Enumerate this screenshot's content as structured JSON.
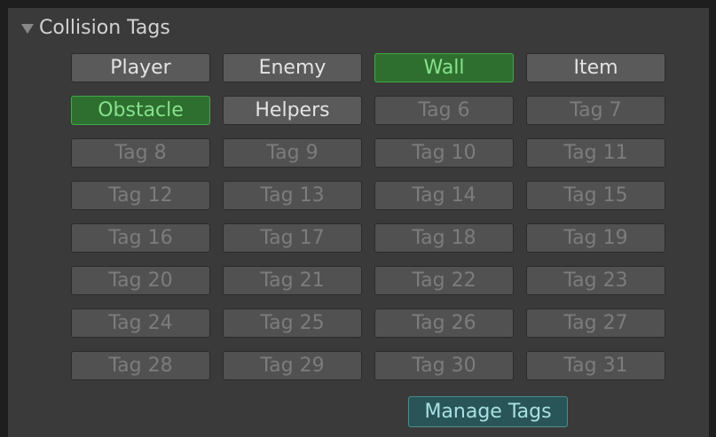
{
  "section": {
    "title": "Collision Tags",
    "caret_icon": "triangle-down-icon"
  },
  "tags": [
    {
      "label": "Player",
      "state": "named"
    },
    {
      "label": "Enemy",
      "state": "named"
    },
    {
      "label": "Wall",
      "state": "active"
    },
    {
      "label": "Item",
      "state": "named"
    },
    {
      "label": "Obstacle",
      "state": "active"
    },
    {
      "label": "Helpers",
      "state": "named"
    },
    {
      "label": "Tag 6",
      "state": "unused"
    },
    {
      "label": "Tag 7",
      "state": "unused"
    },
    {
      "label": "Tag 8",
      "state": "unused"
    },
    {
      "label": "Tag 9",
      "state": "unused"
    },
    {
      "label": "Tag 10",
      "state": "unused"
    },
    {
      "label": "Tag 11",
      "state": "unused"
    },
    {
      "label": "Tag 12",
      "state": "unused"
    },
    {
      "label": "Tag 13",
      "state": "unused"
    },
    {
      "label": "Tag 14",
      "state": "unused"
    },
    {
      "label": "Tag 15",
      "state": "unused"
    },
    {
      "label": "Tag 16",
      "state": "unused"
    },
    {
      "label": "Tag 17",
      "state": "unused"
    },
    {
      "label": "Tag 18",
      "state": "unused"
    },
    {
      "label": "Tag 19",
      "state": "unused"
    },
    {
      "label": "Tag 20",
      "state": "unused"
    },
    {
      "label": "Tag 21",
      "state": "unused"
    },
    {
      "label": "Tag 22",
      "state": "unused"
    },
    {
      "label": "Tag 23",
      "state": "unused"
    },
    {
      "label": "Tag 24",
      "state": "unused"
    },
    {
      "label": "Tag 25",
      "state": "unused"
    },
    {
      "label": "Tag 26",
      "state": "unused"
    },
    {
      "label": "Tag 27",
      "state": "unused"
    },
    {
      "label": "Tag 28",
      "state": "unused"
    },
    {
      "label": "Tag 29",
      "state": "unused"
    },
    {
      "label": "Tag 30",
      "state": "unused"
    },
    {
      "label": "Tag 31",
      "state": "unused"
    }
  ],
  "manage_button": {
    "label": "Manage Tags"
  },
  "colors": {
    "panel_bg": "#3a3a3a",
    "active_bg": "#2e6f30",
    "active_text": "#86e28a",
    "manage_bg": "#2a5558",
    "manage_text": "#a8e0e2"
  }
}
